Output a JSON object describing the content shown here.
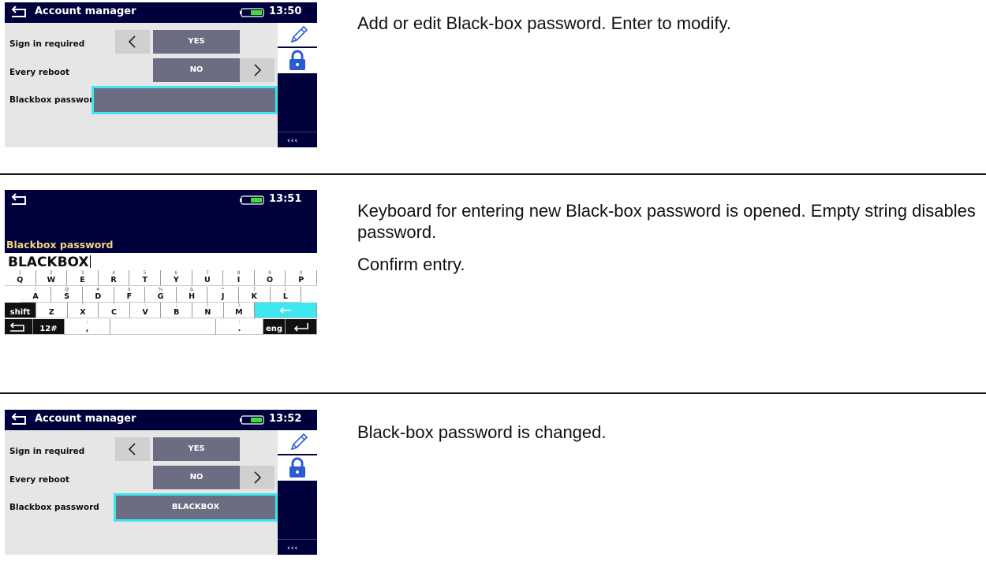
{
  "screen1": {
    "title": "Account manager",
    "time": "13:50",
    "rows": [
      {
        "label": "Sign in required",
        "value": "YES"
      },
      {
        "label": "Every reboot",
        "value": "NO"
      },
      {
        "label": "Blackbox password",
        "value": ""
      }
    ],
    "more_label": "‹‹‹"
  },
  "screen2": {
    "time": "13:51",
    "field_label": "Blackbox password",
    "entry_value": "BLACKBOX",
    "keyboard": {
      "row1": [
        {
          "main": "Q",
          "sec": "1"
        },
        {
          "main": "W",
          "sec": "2"
        },
        {
          "main": "E",
          "sec": "3"
        },
        {
          "main": "R",
          "sec": "4"
        },
        {
          "main": "T",
          "sec": "5"
        },
        {
          "main": "Y",
          "sec": "6"
        },
        {
          "main": "U",
          "sec": "7"
        },
        {
          "main": "I",
          "sec": "8"
        },
        {
          "main": "O",
          "sec": "9"
        },
        {
          "main": "P",
          "sec": "0"
        }
      ],
      "row2": [
        {
          "main": "A",
          "sec": "!"
        },
        {
          "main": "S",
          "sec": "@"
        },
        {
          "main": "D",
          "sec": "#"
        },
        {
          "main": "F",
          "sec": "$"
        },
        {
          "main": "G",
          "sec": "%"
        },
        {
          "main": "H",
          "sec": "&"
        },
        {
          "main": "J",
          "sec": "*"
        },
        {
          "main": "K",
          "sec": "?"
        },
        {
          "main": "L",
          "sec": "/"
        }
      ],
      "row3": [
        {
          "main": "Z",
          "sec": ""
        },
        {
          "main": "X",
          "sec": "\""
        },
        {
          "main": "C",
          "sec": "'"
        },
        {
          "main": "V",
          "sec": ":"
        },
        {
          "main": "B",
          "sec": ";"
        },
        {
          "main": "N",
          "sec": "("
        },
        {
          "main": "M",
          "sec": ")"
        }
      ],
      "shift_label": "shift",
      "symbols_label": "12#",
      "comma": {
        "main": ",",
        "sec": ";"
      },
      "period": {
        "main": ".",
        "sec": ":"
      },
      "language_label": "eng"
    }
  },
  "screen3": {
    "title": "Account manager",
    "time": "13:52",
    "rows": [
      {
        "label": "Sign in required",
        "value": "YES"
      },
      {
        "label": "Every reboot",
        "value": "NO"
      },
      {
        "label": "Blackbox password",
        "value": "BLACKBOX"
      }
    ],
    "more_label": "‹‹‹"
  },
  "descriptions": {
    "step1": [
      "Add or edit Black-box password. Enter to modify."
    ],
    "step2": [
      "Keyboard for entering new Black-box password is opened. Empty string disables password.",
      "Confirm entry."
    ],
    "step3": [
      "Black-box password is changed."
    ]
  },
  "colors": {
    "titlebar": "#00003c",
    "value_box": "#6c6c82",
    "highlight": "#3fe6ee",
    "label_yellow": "#f1d77a",
    "screen_bg": "#e6e6e6"
  },
  "icons": [
    "back-arrow-icon",
    "battery-icon",
    "pencil-icon",
    "lock-icon",
    "chevron-left-icon",
    "chevron-right-icon",
    "enter-icon",
    "backspace-icon"
  ]
}
